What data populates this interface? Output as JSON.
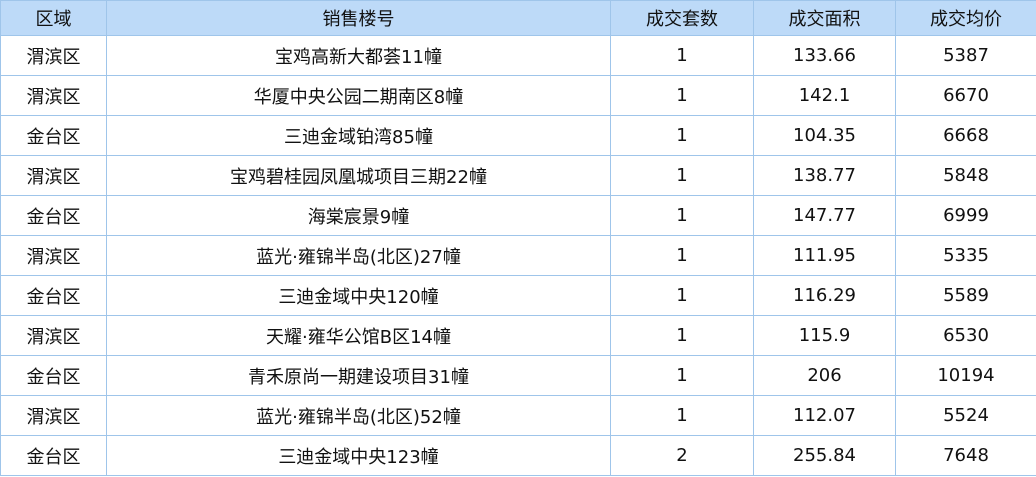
{
  "table": {
    "headers": [
      "区域",
      "销售楼号",
      "成交套数",
      "成交面积",
      "成交均价"
    ],
    "rows": [
      [
        "渭滨区",
        "宝鸡高新大都荟11幢",
        "1",
        "133.66",
        "5387"
      ],
      [
        "渭滨区",
        "华厦中央公园二期南区8幢",
        "1",
        "142.1",
        "6670"
      ],
      [
        "金台区",
        "三迪金域铂湾85幢",
        "1",
        "104.35",
        "6668"
      ],
      [
        "渭滨区",
        "宝鸡碧桂园凤凰城项目三期22幢",
        "1",
        "138.77",
        "5848"
      ],
      [
        "金台区",
        "海棠宸景9幢",
        "1",
        "147.77",
        "6999"
      ],
      [
        "渭滨区",
        "蓝光·雍锦半岛(北区)27幢",
        "1",
        "111.95",
        "5335"
      ],
      [
        "金台区",
        "三迪金域中央120幢",
        "1",
        "116.29",
        "5589"
      ],
      [
        "渭滨区",
        "天耀·雍华公馆B区14幢",
        "1",
        "115.9",
        "6530"
      ],
      [
        "金台区",
        "青禾原尚一期建设项目31幢",
        "1",
        "206",
        "10194"
      ],
      [
        "渭滨区",
        "蓝光·雍锦半岛(北区)52幢",
        "1",
        "112.07",
        "5524"
      ],
      [
        "金台区",
        "三迪金域中央123幢",
        "2",
        "255.84",
        "7648"
      ]
    ]
  },
  "colors": {
    "header_bg": "#bddaf8",
    "border": "#9fc5ea"
  }
}
